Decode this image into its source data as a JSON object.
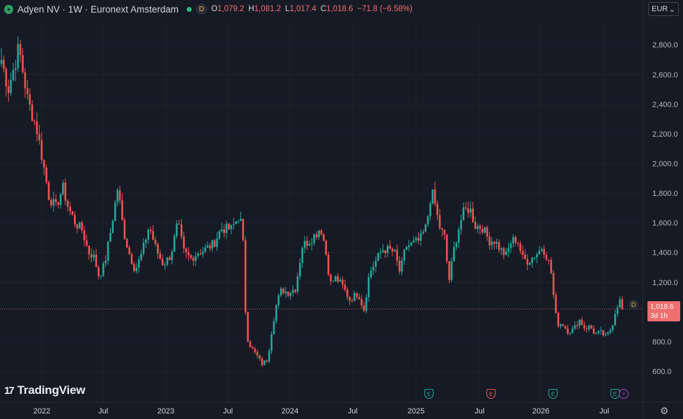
{
  "legend": {
    "title": "Adyen NV · 1W · Euronext Amsterdam",
    "badge": "D",
    "open_key": "O",
    "open": "1,079.2",
    "high_key": "H",
    "high": "1,081.2",
    "low_key": "L",
    "low": "1,017.4",
    "close_key": "C",
    "close": "1,018.6",
    "change": "−71.8 (−6.58%)"
  },
  "currency": {
    "label": "EUR",
    "chevron": "⌄"
  },
  "price_tag": {
    "price": "1,018.6",
    "countdown": "3d 1h"
  },
  "marker": {
    "label": "D"
  },
  "brand": {
    "mark": "17",
    "name": "TradingView"
  },
  "events": [
    {
      "label": "E",
      "kind": "green"
    },
    {
      "label": "E",
      "kind": "red"
    },
    {
      "label": "E",
      "kind": "green"
    },
    {
      "label": "E",
      "kind": "green"
    }
  ],
  "dividend_event": {
    "label": "⚡"
  },
  "colors": {
    "background": "#161a25",
    "up": "#26a69a",
    "down": "#ef5350",
    "grid": "#1e222d",
    "price_line": "#f16e6e"
  },
  "chart_data": {
    "type": "candlestick",
    "interval": "1W",
    "currency": "EUR",
    "y_ticks": [
      "2,800.0",
      "2,600.0",
      "2,400.0",
      "2,200.0",
      "2,000.0",
      "1,800.0",
      "1,600.0",
      "1,400.0",
      "1,200.0",
      "800.0",
      "600.0"
    ],
    "y_tick_values": [
      2800,
      2600,
      2400,
      2200,
      2000,
      1800,
      1600,
      1400,
      1200,
      800,
      600
    ],
    "x_ticks": [
      "2022",
      "Jul",
      "2023",
      "Jul",
      "2024",
      "Jul",
      "2025",
      "Jul",
      "2026",
      "Jul"
    ],
    "ylim": [
      520,
      2880
    ],
    "last_price": 1018.6,
    "anchors": [
      [
        0,
        2700
      ],
      [
        10,
        2500
      ],
      [
        25,
        2780
      ],
      [
        38,
        2420
      ],
      [
        50,
        2250
      ],
      [
        60,
        2000
      ],
      [
        68,
        1780
      ],
      [
        78,
        1700
      ],
      [
        88,
        1840
      ],
      [
        96,
        1700
      ],
      [
        106,
        1600
      ],
      [
        116,
        1550
      ],
      [
        125,
        1400
      ],
      [
        132,
        1380
      ],
      [
        140,
        1240
      ],
      [
        148,
        1320
      ],
      [
        157,
        1550
      ],
      [
        167,
        1840
      ],
      [
        175,
        1550
      ],
      [
        183,
        1400
      ],
      [
        192,
        1280
      ],
      [
        202,
        1400
      ],
      [
        212,
        1580
      ],
      [
        222,
        1420
      ],
      [
        232,
        1320
      ],
      [
        243,
        1380
      ],
      [
        253,
        1600
      ],
      [
        262,
        1400
      ],
      [
        272,
        1360
      ],
      [
        282,
        1400
      ],
      [
        292,
        1420
      ],
      [
        305,
        1460
      ],
      [
        315,
        1560
      ],
      [
        330,
        1560
      ],
      [
        340,
        1640
      ],
      [
        346,
        1580
      ],
      [
        349,
        1120
      ],
      [
        352,
        840
      ],
      [
        358,
        760
      ],
      [
        366,
        710
      ],
      [
        374,
        650
      ],
      [
        382,
        680
      ],
      [
        388,
        880
      ],
      [
        395,
        1060
      ],
      [
        402,
        1150
      ],
      [
        412,
        1130
      ],
      [
        422,
        1160
      ],
      [
        432,
        1450
      ],
      [
        442,
        1480
      ],
      [
        452,
        1530
      ],
      [
        458,
        1570
      ],
      [
        464,
        1450
      ],
      [
        472,
        1190
      ],
      [
        480,
        1230
      ],
      [
        490,
        1170
      ],
      [
        500,
        1080
      ],
      [
        512,
        1130
      ],
      [
        520,
        1010
      ],
      [
        528,
        1260
      ],
      [
        538,
        1350
      ],
      [
        546,
        1420
      ],
      [
        556,
        1420
      ],
      [
        564,
        1400
      ],
      [
        572,
        1260
      ],
      [
        580,
        1440
      ],
      [
        590,
        1460
      ],
      [
        600,
        1480
      ],
      [
        610,
        1580
      ],
      [
        617,
        1820
      ],
      [
        622,
        1730
      ],
      [
        628,
        1580
      ],
      [
        636,
        1500
      ],
      [
        642,
        1200
      ],
      [
        650,
        1440
      ],
      [
        658,
        1600
      ],
      [
        664,
        1680
      ],
      [
        672,
        1700
      ],
      [
        680,
        1580
      ],
      [
        690,
        1570
      ],
      [
        700,
        1480
      ],
      [
        708,
        1480
      ],
      [
        716,
        1420
      ],
      [
        724,
        1380
      ],
      [
        732,
        1480
      ],
      [
        740,
        1490
      ],
      [
        748,
        1360
      ],
      [
        756,
        1340
      ],
      [
        764,
        1380
      ],
      [
        770,
        1400
      ],
      [
        776,
        1440
      ],
      [
        782,
        1380
      ],
      [
        788,
        1300
      ],
      [
        792,
        1120
      ],
      [
        797,
        920
      ],
      [
        805,
        920
      ],
      [
        813,
        870
      ],
      [
        821,
        880
      ],
      [
        829,
        950
      ],
      [
        837,
        890
      ],
      [
        845,
        900
      ],
      [
        852,
        850
      ],
      [
        860,
        860
      ],
      [
        868,
        830
      ],
      [
        876,
        900
      ],
      [
        882,
        1030
      ],
      [
        888,
        1080
      ],
      [
        893,
        1019
      ]
    ]
  }
}
